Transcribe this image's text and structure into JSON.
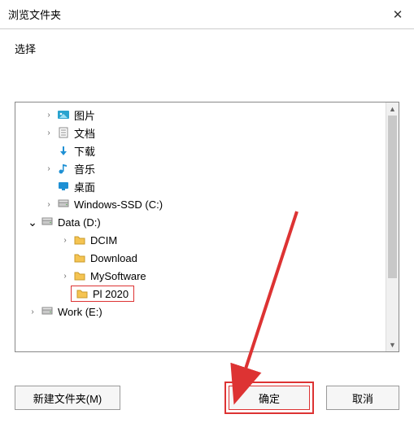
{
  "title": "浏览文件夹",
  "prompt": "选择",
  "tree": [
    {
      "indent": 1,
      "twisty": ">",
      "icon": "pictures",
      "label": "图片"
    },
    {
      "indent": 1,
      "twisty": ">",
      "icon": "documents",
      "label": "文档"
    },
    {
      "indent": 1,
      "twisty": "",
      "icon": "downloads",
      "label": "下载"
    },
    {
      "indent": 1,
      "twisty": ">",
      "icon": "music",
      "label": "音乐"
    },
    {
      "indent": 1,
      "twisty": "",
      "icon": "desktop",
      "label": "桌面"
    },
    {
      "indent": 1,
      "twisty": ">",
      "icon": "drive",
      "label": "Windows-SSD (C:)"
    },
    {
      "indent": 0,
      "twisty": "v",
      "icon": "drive",
      "label": "Data (D:)"
    },
    {
      "indent": 2,
      "twisty": ">",
      "icon": "folder",
      "label": "DCIM"
    },
    {
      "indent": 2,
      "twisty": "",
      "icon": "folder",
      "label": "Download"
    },
    {
      "indent": 2,
      "twisty": ">",
      "icon": "folder",
      "label": "MySoftware"
    },
    {
      "indent": 2,
      "twisty": "",
      "icon": "folder",
      "label": "Pl 2020",
      "selected": true
    },
    {
      "indent": 0,
      "twisty": ">",
      "icon": "drive",
      "label": "Work (E:)"
    }
  ],
  "buttons": {
    "new_folder": "新建文件夹(M)",
    "ok": "确定",
    "cancel": "取消"
  }
}
